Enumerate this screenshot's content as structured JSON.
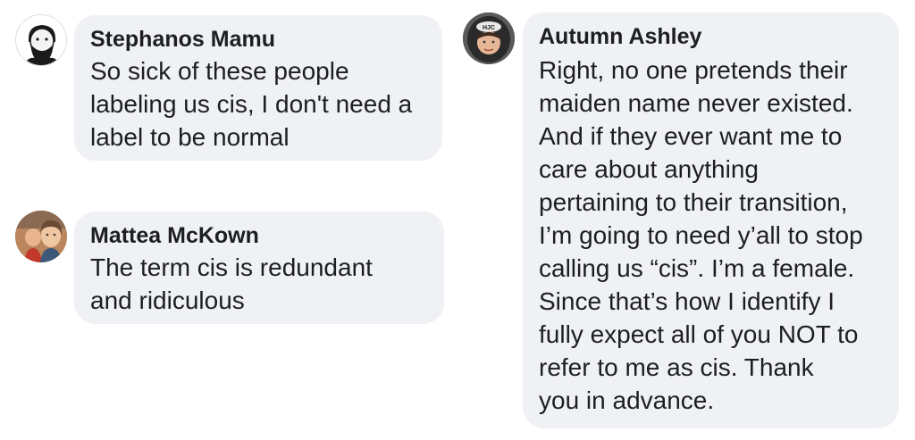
{
  "comments": [
    {
      "author": "Stephanos Mamu",
      "avatar_icon": "cartoon-bearded-man-avatar",
      "lines": [
        "So sick of these people",
        "labeling us cis, I don't need a",
        "label to be normal"
      ]
    },
    {
      "author": "Mattea McKown",
      "avatar_icon": "photo-avatar",
      "lines": [
        "The term cis is redundant",
        "and ridiculous"
      ]
    },
    {
      "author": "Autumn Ashley",
      "avatar_icon": "helmet-photo-avatar",
      "lines": [
        "Right, no one pretends their",
        "maiden name never existed.",
        "And if they ever want me to",
        "care about anything",
        "pertaining to their transition,",
        "I’m going to need y’all to stop",
        "calling us “cis”.  I’m a female.",
        "Since that’s how I identify I",
        "fully expect all of you NOT to",
        "refer to me as cis.  Thank",
        "you in advance."
      ]
    }
  ],
  "colors": {
    "bubble_bg": "#f0f1f5",
    "text": "#1c1e21"
  }
}
